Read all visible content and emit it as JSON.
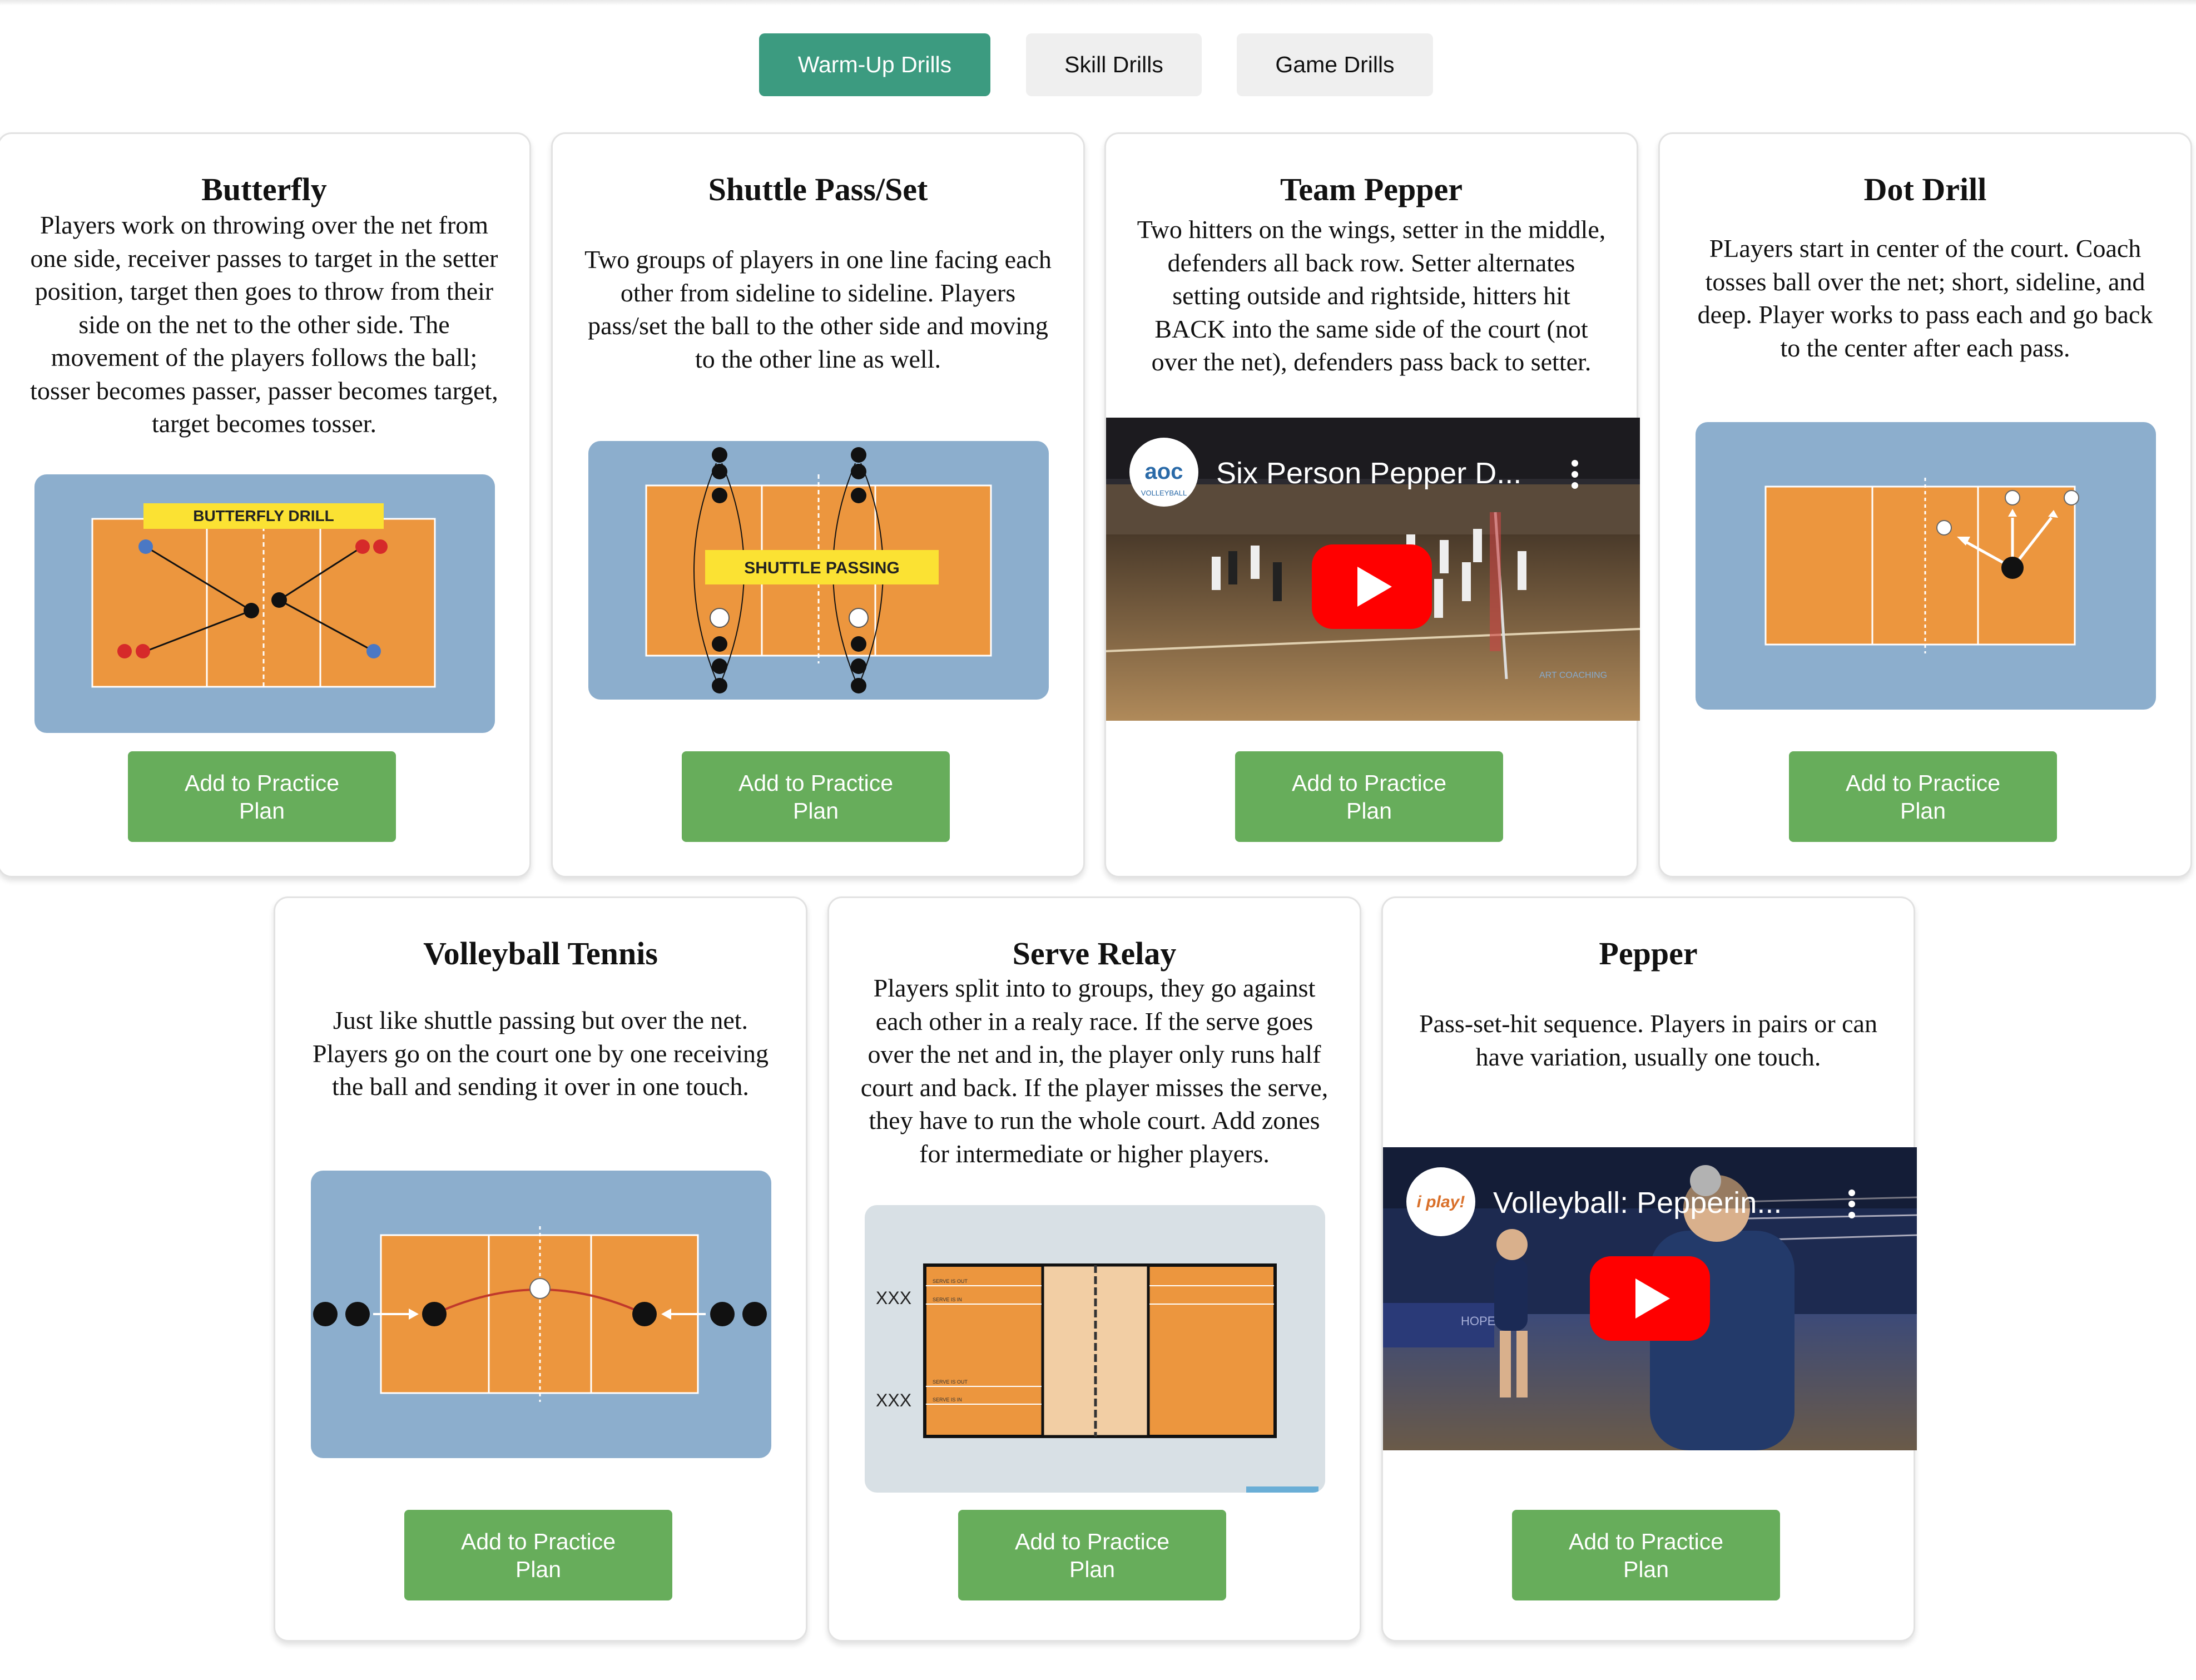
{
  "tabs": [
    {
      "label": "Warm-Up Drills",
      "active": true
    },
    {
      "label": "Skill Drills",
      "active": false
    },
    {
      "label": "Game Drills",
      "active": false
    }
  ],
  "colors": {
    "active_tab": "#3c9b80",
    "button": "#67ad5b",
    "court": "#ec963e",
    "court_bg": "#8caecd"
  },
  "cards": [
    {
      "title": "Butterfly",
      "description": "Players work on throwing over the net from one side, receiver passes to target in the setter position, target then goes to throw from their side on the net to the other side. The movement of the players follows the ball; tosser becomes passer, passer becomes target, target becomes tosser.",
      "diagram_label": "BUTTERFLY DRILL",
      "button": "Add to Practice Plan"
    },
    {
      "title": "Shuttle Pass/Set",
      "description": "Two groups of players in one line facing each other from sideline to sideline. Players pass/set the ball to the other side and moving to the other line as well.",
      "diagram_label": "SHUTTLE PASSING",
      "button": "Add to Practice Plan"
    },
    {
      "title": "Team Pepper",
      "description": "Two hitters on the wings, setter in the middle, defenders all back row. Setter alternates setting outside and rightside, hitters hit BACK into the same side of the court (not over the net), defenders pass back to setter.",
      "video_title": "Six Person Pepper D...",
      "video_channel": "VOLLEYBALL",
      "video_watermark": "ART COACHING",
      "button": "Add to Practice Plan"
    },
    {
      "title": "Dot Drill",
      "description": "PLayers start in center of the court. Coach tosses ball over the net; short, sideline, and deep. Player works to pass each and go back to the center after each pass.",
      "button": "Add to Practice Plan"
    },
    {
      "title": "Volleyball Tennis",
      "description": "Just like shuttle passing but over the net. Players go on the court one by one receiving the ball and sending it over in one touch.",
      "button": "Add to Practice Plan"
    },
    {
      "title": "Serve Relay",
      "description": "Players split into to groups, they go against each other in a realy race. If the serve goes over the net and in, the player only runs half court and back. If the player misses the serve, they have to run the whole court. Add zones for intermediate or higher players.",
      "diagram_rows": [
        "XXX",
        "XXX"
      ],
      "diagram_marks": [
        "SERVE IS OUT",
        "SERVE IS IN",
        "SERVE IS OUT",
        "SERVE IS IN"
      ],
      "button": "Add to Practice Plan"
    },
    {
      "title": "Pepper",
      "description": "Pass-set-hit sequence. Players in pairs or can have variation, usually one touch.",
      "video_title": "Volleyball: Pepperin...",
      "video_channel": "i play!",
      "video_watermark": "HOPE",
      "button": "Add to Practice Plan"
    }
  ]
}
